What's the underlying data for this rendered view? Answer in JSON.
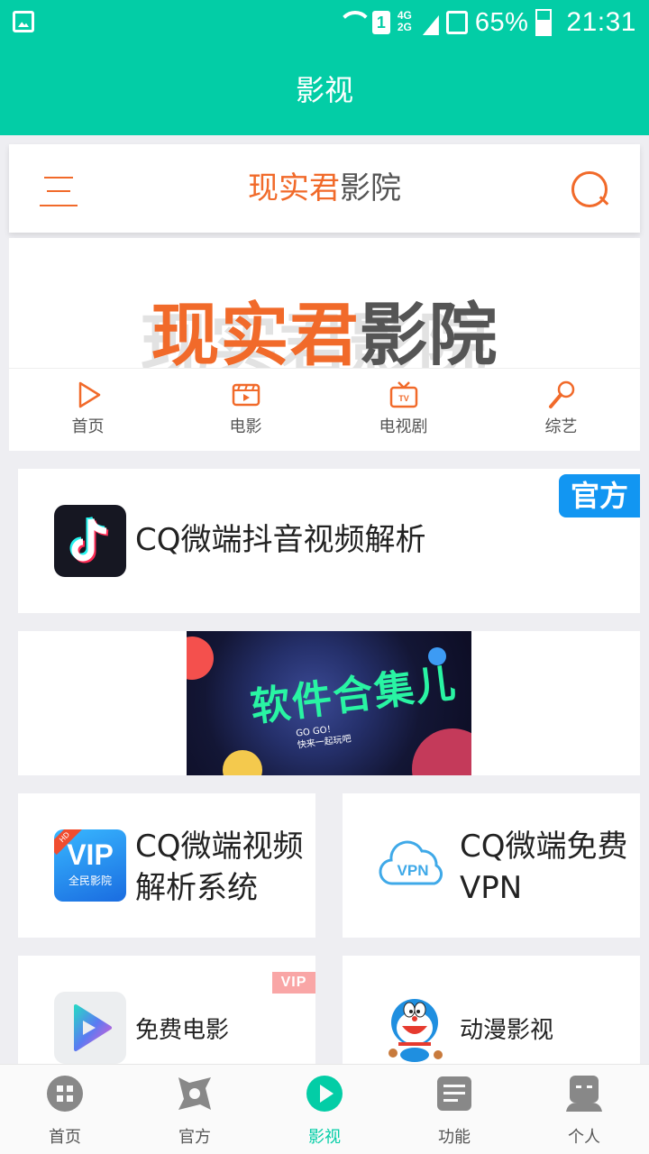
{
  "status_bar": {
    "network_4g": "4G",
    "network_2g": "2G",
    "sim_slot": "1",
    "battery_percent": "65%",
    "battery_level": 0.65,
    "time": "21:31"
  },
  "app_bar": {
    "title": "影视"
  },
  "site": {
    "title_orange": "现实君",
    "title_gray": "影院",
    "banner_orange": "现实君",
    "banner_gray": "影院"
  },
  "nav": {
    "items": [
      {
        "label": "首页",
        "icon": "play-icon"
      },
      {
        "label": "电影",
        "icon": "film-icon"
      },
      {
        "label": "电视剧",
        "icon": "tv-icon"
      },
      {
        "label": "综艺",
        "icon": "microphone-icon"
      }
    ]
  },
  "cards": {
    "tiktok": {
      "title": "CQ微端抖音视频解析",
      "badge": "官方",
      "badge_color": "#1296f2"
    },
    "promo": {
      "text": "软件合集儿",
      "subtitle_1": "GO GO！",
      "subtitle_2": "快来一起玩吧"
    },
    "vip": {
      "title": "CQ微端视频解析系统",
      "logo_hd": "HD",
      "logo_vip": "VIP",
      "logo_sub": "全民影院"
    },
    "vpn": {
      "title": "CQ微端免费VPN",
      "logo_text": "VPN"
    },
    "movie": {
      "title": "免费电影",
      "badge": "VIP"
    },
    "anime": {
      "title": "动漫影视"
    }
  },
  "tabbar": {
    "items": [
      {
        "label": "首页",
        "icon": "home-icon"
      },
      {
        "label": "官方",
        "icon": "official-icon"
      },
      {
        "label": "影视",
        "icon": "video-icon"
      },
      {
        "label": "功能",
        "icon": "function-icon"
      },
      {
        "label": "个人",
        "icon": "person-icon"
      }
    ],
    "active_color": "#03cda6",
    "inactive_color": "#888888"
  },
  "colors": {
    "primary": "#03cda6",
    "accent": "#f16a2a"
  }
}
